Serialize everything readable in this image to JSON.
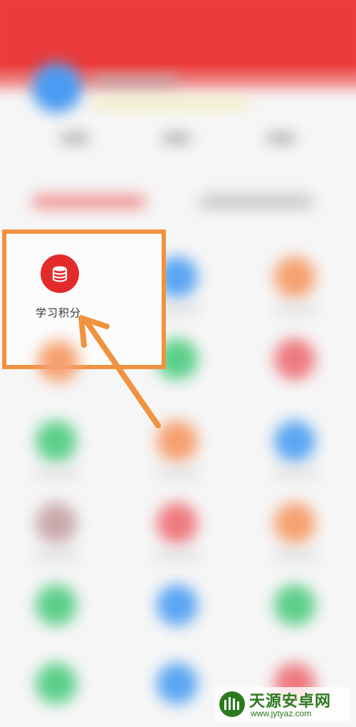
{
  "feature": {
    "label": "学习积分",
    "icon": "database-icon"
  },
  "watermark": {
    "title": "天源安卓网",
    "url": "www.jytyaz.com"
  },
  "colors": {
    "header": "#ec3b3b",
    "highlight_border": "#f09340",
    "arrow": "#f09340",
    "feature_icon_bg": "#e32b2b"
  }
}
